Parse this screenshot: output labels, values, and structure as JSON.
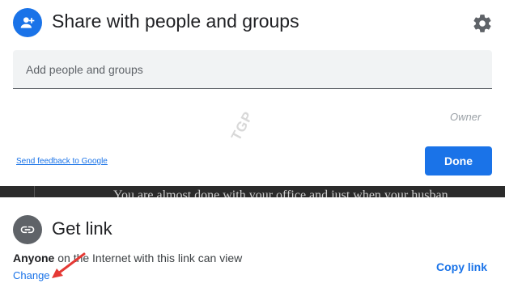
{
  "share": {
    "title": "Share with people and groups",
    "input_placeholder": "Add people and groups",
    "owner_label": "Owner",
    "feedback_link": "Send feedback to Google",
    "done_label": "Done",
    "icons": [
      "person-add-icon",
      "gear-icon"
    ]
  },
  "watermark": "TGP",
  "background_document": {
    "text": "You are almost done with your office and just when your husban"
  },
  "get_link": {
    "title": "Get link",
    "access_strong": "Anyone",
    "access_rest": " on the Internet with this link can view",
    "change_label": "Change",
    "copy_label": "Copy link",
    "icons": [
      "link-icon"
    ]
  },
  "colors": {
    "accent": "#1a73e8",
    "annotation_arrow": "#e53935"
  }
}
